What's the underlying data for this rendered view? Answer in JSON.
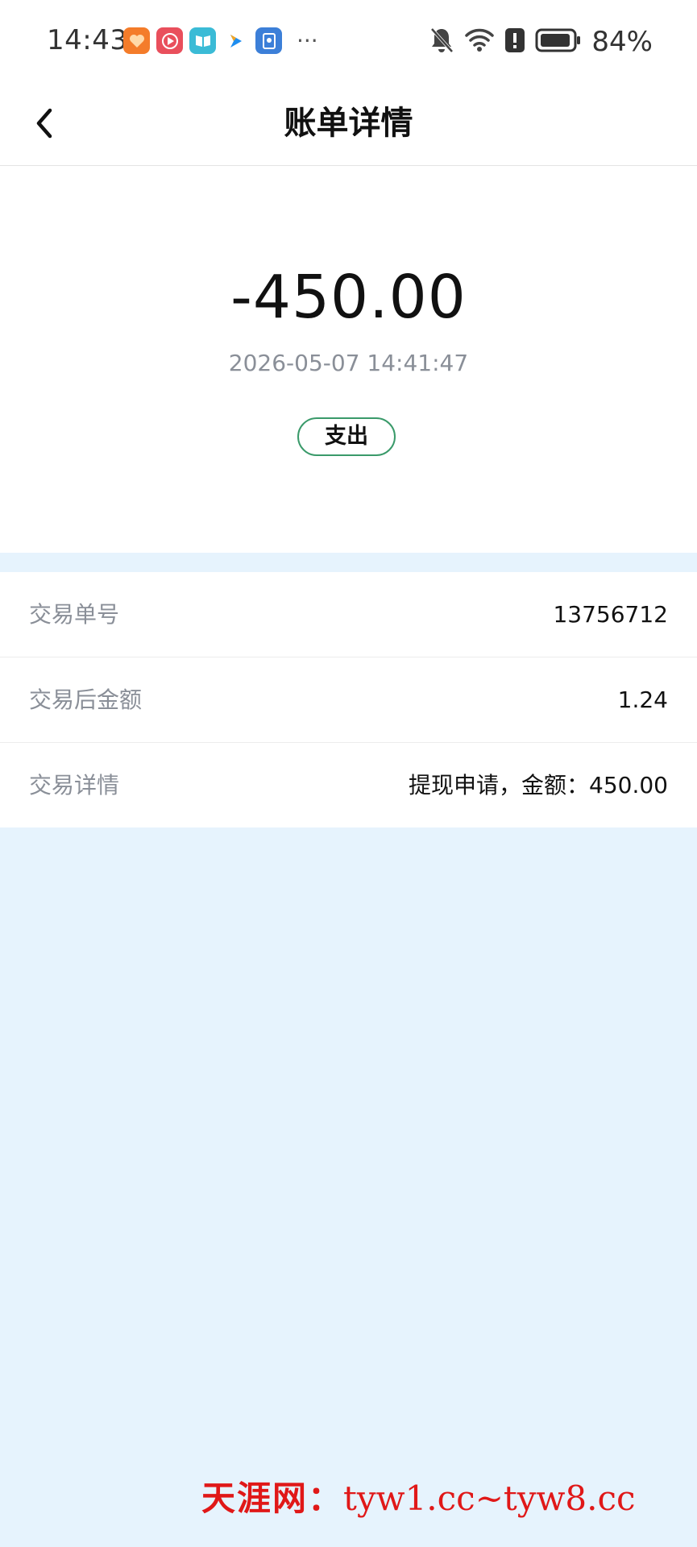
{
  "status_bar": {
    "time": "14:43",
    "more": "···",
    "battery": "84%",
    "notification_icons": [
      "heart-app-icon",
      "video-app-icon",
      "book-app-icon",
      "arrow-app-icon",
      "card-app-icon"
    ],
    "system_icons": [
      "bell-off-icon",
      "wifi-icon",
      "alert-icon",
      "battery-icon"
    ]
  },
  "nav": {
    "title": "账单详情"
  },
  "summary": {
    "amount": "-450.00",
    "datetime": "2026-05-07 14:41:47",
    "type": "支出"
  },
  "details": {
    "rows": [
      {
        "label": "交易单号",
        "value": "13756712"
      },
      {
        "label": "交易后金额",
        "value": "1.24"
      },
      {
        "label": "交易详情",
        "value": "提现申请，金额：450.00"
      }
    ]
  },
  "watermark": {
    "text_cn": "天涯网：",
    "text_url": "tyw1.cc~tyw8.cc"
  },
  "colors": {
    "page_background": "#e6f3fd",
    "badge_border": "#3a9a6a",
    "label_gray": "#8a8f98",
    "watermark_red": "#e01818"
  }
}
